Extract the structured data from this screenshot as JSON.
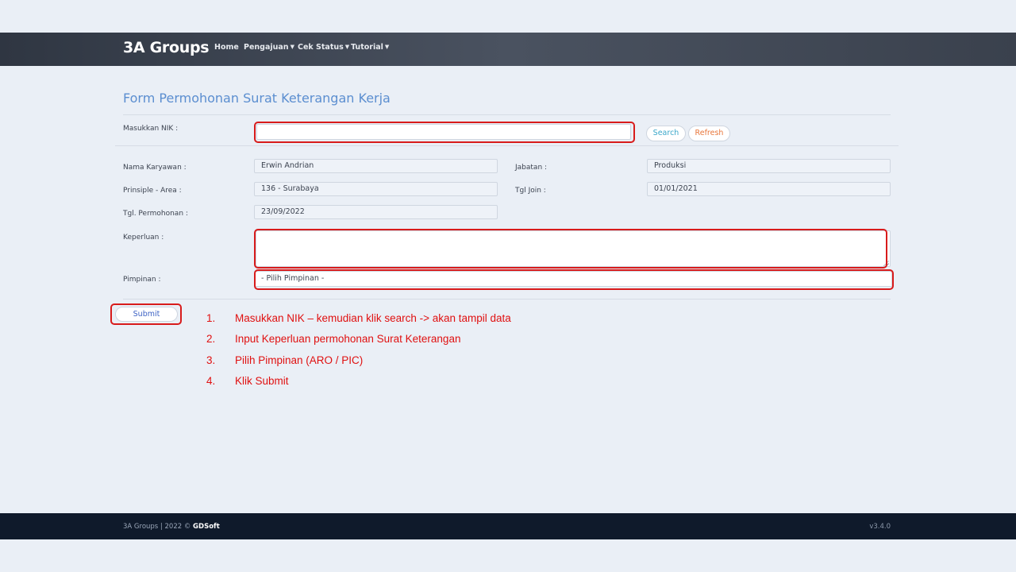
{
  "nav": {
    "brand": "3A Groups",
    "items": [
      {
        "label": "Home",
        "dropdown": false
      },
      {
        "label": "Pengajuan",
        "dropdown": true
      },
      {
        "label": "Cek Status",
        "dropdown": true
      },
      {
        "label": "Tutorial",
        "dropdown": true
      }
    ]
  },
  "form": {
    "title": "Form Permohonan Surat Keterangan Kerja",
    "nik": {
      "label": "Masukkan NIK :",
      "value": ""
    },
    "search_button": "Search",
    "refresh_button": "Refresh",
    "fields": {
      "nama": {
        "label": "Nama Karyawan :",
        "value": "Erwin Andrian"
      },
      "jabatan": {
        "label": "Jabatan :",
        "value": "Produksi"
      },
      "principle": {
        "label": "Prinsiple - Area :",
        "value": "136 - Surabaya"
      },
      "tgl_join": {
        "label": "Tgl Join :",
        "value": "01/01/2021"
      },
      "tgl_permohonan": {
        "label": "Tgl. Permohonan :",
        "value": "23/09/2022"
      }
    },
    "keperluan": {
      "label": "Keperluan :",
      "value": ""
    },
    "pimpinan": {
      "label": "Pimpinan :",
      "selected": "- Pilih Pimpinan -"
    },
    "submit_button": "Submit"
  },
  "instructions": [
    {
      "num": "1.",
      "text": "Masukkan NIK – kemudian klik  search -> akan tampil data"
    },
    {
      "num": "2.",
      "text": "Input Keperluan permohonan Surat Keterangan"
    },
    {
      "num": "3.",
      "text": "Pilih  Pimpinan  (ARO / PIC)"
    },
    {
      "num": "4.",
      "text": "Klik  Submit"
    }
  ],
  "footer": {
    "copyright": "3A Groups | 2022 ©",
    "company": "GDSoft",
    "version": "v3.4.0"
  },
  "colors": {
    "title": "#5b8ed0",
    "highlight": "#d81b1b",
    "search": "#3aa7c9",
    "refresh": "#e8763a",
    "submit": "#3d62c4",
    "navbar": "#3a414d",
    "footer": "#0f1a2b"
  }
}
